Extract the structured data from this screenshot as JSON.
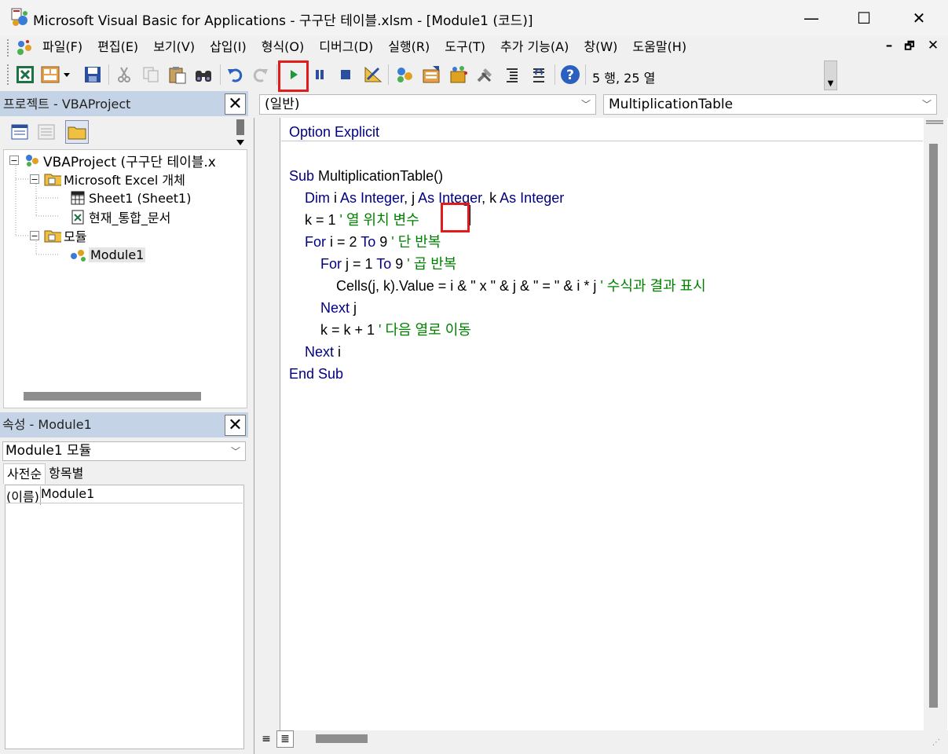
{
  "window": {
    "title": "Microsoft Visual Basic for Applications - 구구단 테이블.xlsm - [Module1 (코드)]",
    "minimize_glyph": "—",
    "maximize_glyph": "☐",
    "close_glyph": "✕"
  },
  "menu": {
    "items": [
      "파일(F)",
      "편집(E)",
      "보기(V)",
      "삽입(I)",
      "형식(O)",
      "디버그(D)",
      "실행(R)",
      "도구(T)",
      "추가 기능(A)",
      "창(W)",
      "도움말(H)"
    ],
    "mdi_minimize": "–",
    "mdi_restore": "🗗",
    "mdi_close": "✕"
  },
  "toolbar": {
    "cursor_position": "5 행, 25 열",
    "icons": [
      "excel-icon",
      "insert-module-icon",
      "save-icon",
      "cut-icon",
      "copy-icon",
      "paste-icon",
      "find-icon",
      "undo-icon",
      "redo-icon",
      "run-icon",
      "break-icon",
      "reset-icon",
      "design-mode-icon",
      "project-explorer-icon",
      "properties-icon",
      "object-browser-icon",
      "toolbox-icon",
      "tab-order-icon",
      "call-stack-icon",
      "help-icon"
    ]
  },
  "project_panel": {
    "title": "프로젝트 - VBAProject",
    "tree": {
      "root": "VBAProject (구구단 테이블.x",
      "excel_objects": "Microsoft Excel 개체",
      "sheet1": "Sheet1 (Sheet1)",
      "workbook": "현재_통합_문서",
      "modules": "모듈",
      "module1": "Module1"
    }
  },
  "properties_panel": {
    "title": "속성 - Module1",
    "object_combo": "Module1 모듈",
    "tabs": [
      "사전순",
      "항목별"
    ],
    "property_name": "(이름)",
    "property_value": "Module1"
  },
  "code_window": {
    "object_combo": "(일반)",
    "procedure_combo": "MultiplicationTable",
    "lines": [
      [
        {
          "t": "Option Explicit",
          "c": "kw"
        }
      ],
      [],
      [
        {
          "t": "Sub ",
          "c": "kw"
        },
        {
          "t": "MultiplicationTable()",
          "c": "tx"
        }
      ],
      [
        {
          "t": "    Dim ",
          "c": "kw"
        },
        {
          "t": "i ",
          "c": "tx"
        },
        {
          "t": "As Integer",
          "c": "kw"
        },
        {
          "t": ", j ",
          "c": "tx"
        },
        {
          "t": "As Integer",
          "c": "kw"
        },
        {
          "t": ", k ",
          "c": "tx"
        },
        {
          "t": "As Integer",
          "c": "kw"
        }
      ],
      [
        {
          "t": "    k = 1 ",
          "c": "tx"
        },
        {
          "t": "' 열 위치 변수",
          "c": "cm"
        }
      ],
      [
        {
          "t": "    For ",
          "c": "kw"
        },
        {
          "t": "i = 2 ",
          "c": "tx"
        },
        {
          "t": "To ",
          "c": "kw"
        },
        {
          "t": "9 ",
          "c": "tx"
        },
        {
          "t": "' 단 반복",
          "c": "cm"
        }
      ],
      [
        {
          "t": "        For ",
          "c": "kw"
        },
        {
          "t": "j = 1 ",
          "c": "tx"
        },
        {
          "t": "To ",
          "c": "kw"
        },
        {
          "t": "9 ",
          "c": "tx"
        },
        {
          "t": "' 곱 반복",
          "c": "cm"
        }
      ],
      [
        {
          "t": "            Cells(j, k).Value = i & \" x \" & j & \" = \" & i * j ",
          "c": "tx"
        },
        {
          "t": "' 수식과 결과 표시",
          "c": "cm"
        }
      ],
      [
        {
          "t": "        Next ",
          "c": "kw"
        },
        {
          "t": "j",
          "c": "tx"
        }
      ],
      [
        {
          "t": "        k = k + 1 ",
          "c": "tx"
        },
        {
          "t": "' 다음 열로 이동",
          "c": "cm"
        }
      ],
      [
        {
          "t": "    Next ",
          "c": "kw"
        },
        {
          "t": "i",
          "c": "tx"
        }
      ],
      [
        {
          "t": "End Sub",
          "c": "kw"
        }
      ]
    ]
  },
  "colors": {
    "keyword": "#00007f",
    "comment": "#008000",
    "highlight": "#e21b1b",
    "panel_header": "#c4d3e6"
  }
}
